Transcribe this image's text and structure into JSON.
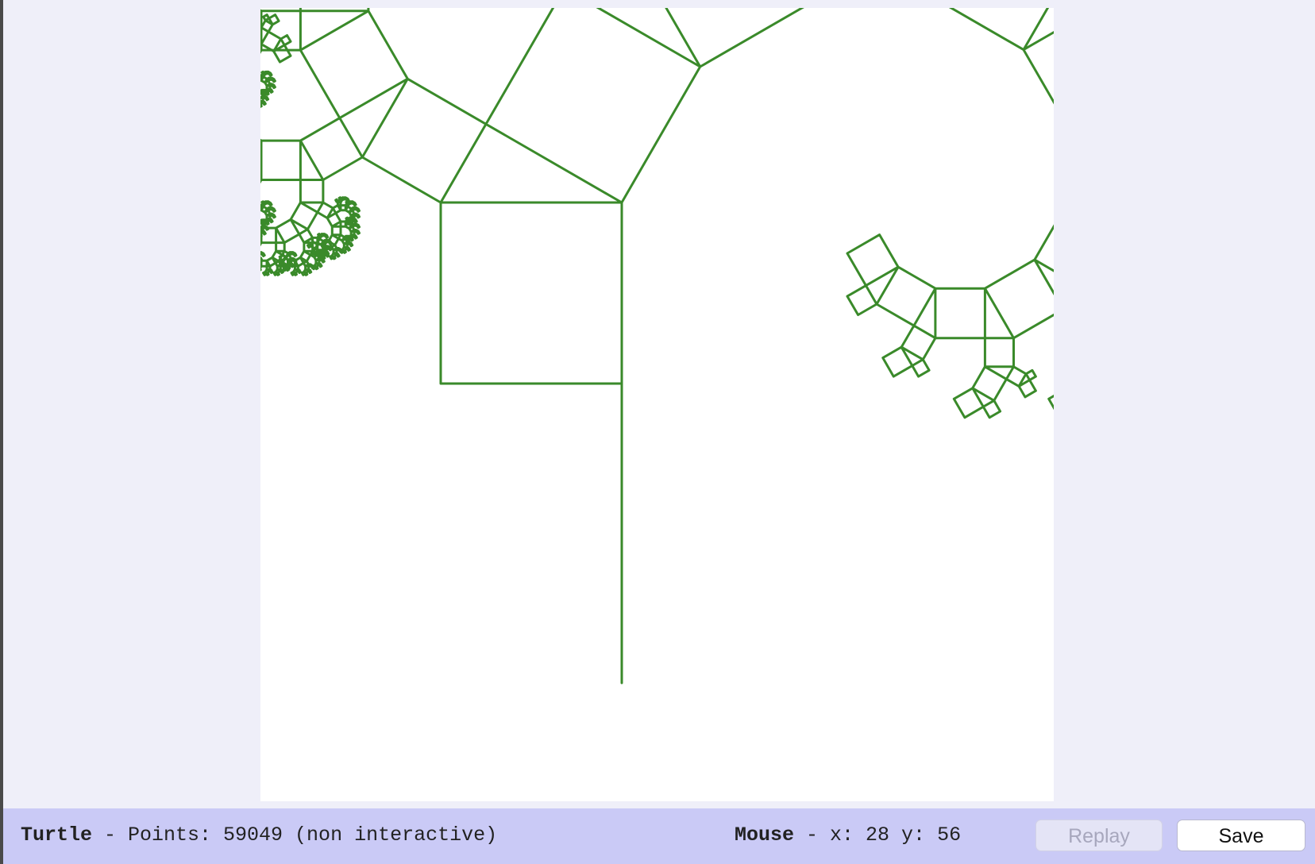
{
  "canvas": {
    "line_color": "#3a8a2a",
    "background": "#ffffff"
  },
  "status": {
    "app_name": "Turtle",
    "points_text": " - Points: 59049 (non interactive)",
    "mouse_label": "Mouse",
    "mouse_sep": " - x: ",
    "mouse_x": "28",
    "mouse_y_label": " y: ",
    "mouse_y": "56"
  },
  "buttons": {
    "replay_label": "Replay",
    "save_label": "Save"
  },
  "colors": {
    "page_background": "#efeff9",
    "status_bar": "#cacaf6",
    "drawing": "#3a8a2a"
  }
}
